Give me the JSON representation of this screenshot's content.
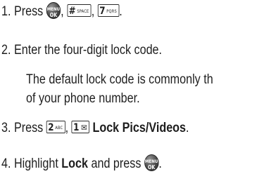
{
  "steps": [
    {
      "num": "1.",
      "text": "Press"
    },
    {
      "num": "2.",
      "text": "Enter the four-digit lock code."
    },
    {
      "num": "3.",
      "text": "Press",
      "bold": "Lock Pics/Videos",
      "end": "."
    },
    {
      "num": "4.",
      "pre": "Highlight",
      "bold": "Lock",
      "mid": "and press",
      "end": "."
    }
  ],
  "step2_note": {
    "line1": "The default lock code is commonly th",
    "line2": "of your phone number."
  },
  "punct": {
    "comma": ",",
    "period": "."
  },
  "keys": {
    "menu_ok": {
      "top": "MENU",
      "bottom": "OK"
    },
    "pound": {
      "big": "#",
      "small": "SPACE"
    },
    "seven": {
      "big": "7",
      "small": "PQRS"
    },
    "two": {
      "big": "2",
      "small": "ABC"
    },
    "one": {
      "big": "1",
      "small": "✉"
    }
  }
}
